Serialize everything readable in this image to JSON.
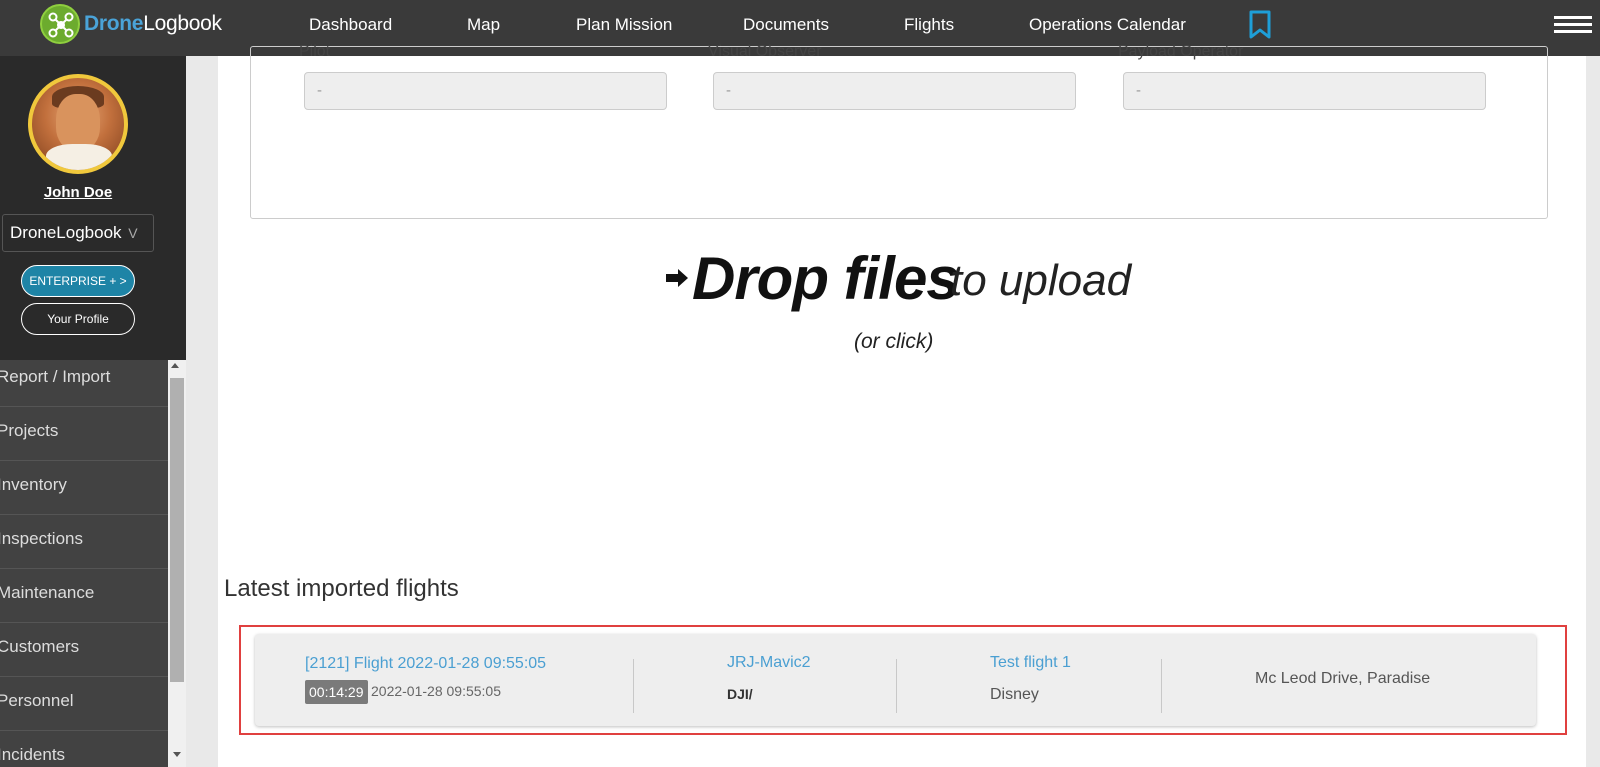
{
  "brand": {
    "name_accent": "Drone",
    "name_rest": "Logbook"
  },
  "nav": {
    "items": [
      "Dashboard",
      "Map",
      "Plan Mission",
      "Documents",
      "Flights",
      "Operations Calendar"
    ]
  },
  "profile": {
    "name": "John Doe",
    "organization": "DroneLogbook",
    "enterprise_label": "ENTERPRISE + >",
    "profile_label": "Your Profile"
  },
  "sidebar": {
    "items": [
      "Report / Import",
      "Projects",
      "Inventory",
      "Inspections",
      "Maintenance",
      "Customers",
      "Personnel",
      "Incidents"
    ]
  },
  "crew": {
    "pilot_label": "Pilot",
    "pilot_value": "-",
    "observer_label": "Visual Observer",
    "observer_value": "-",
    "payload_label": "Payload Operator",
    "payload_value": "-"
  },
  "dropzone": {
    "bold_text": "Drop files",
    "light_text": "to upload",
    "sub_text": "(or click)"
  },
  "latest": {
    "title": "Latest imported flights",
    "flights": [
      {
        "title": "[2121] Flight 2022-01-28 09:55:05",
        "duration": "00:14:29",
        "date": "2022-01-28 09:55:05",
        "drone": "JRJ-Mavic2",
        "manufacturer": "DJI/",
        "mission": "Test flight 1",
        "customer": "Disney",
        "location": "Mc Leod Drive, Paradise"
      }
    ]
  },
  "colors": {
    "topbar": "#3a3a3a",
    "accent_blue": "#4a9fd2",
    "enterprise_button": "#1e84a6",
    "highlight_red": "#e0403f",
    "avatar_ring": "#f0c83c"
  }
}
